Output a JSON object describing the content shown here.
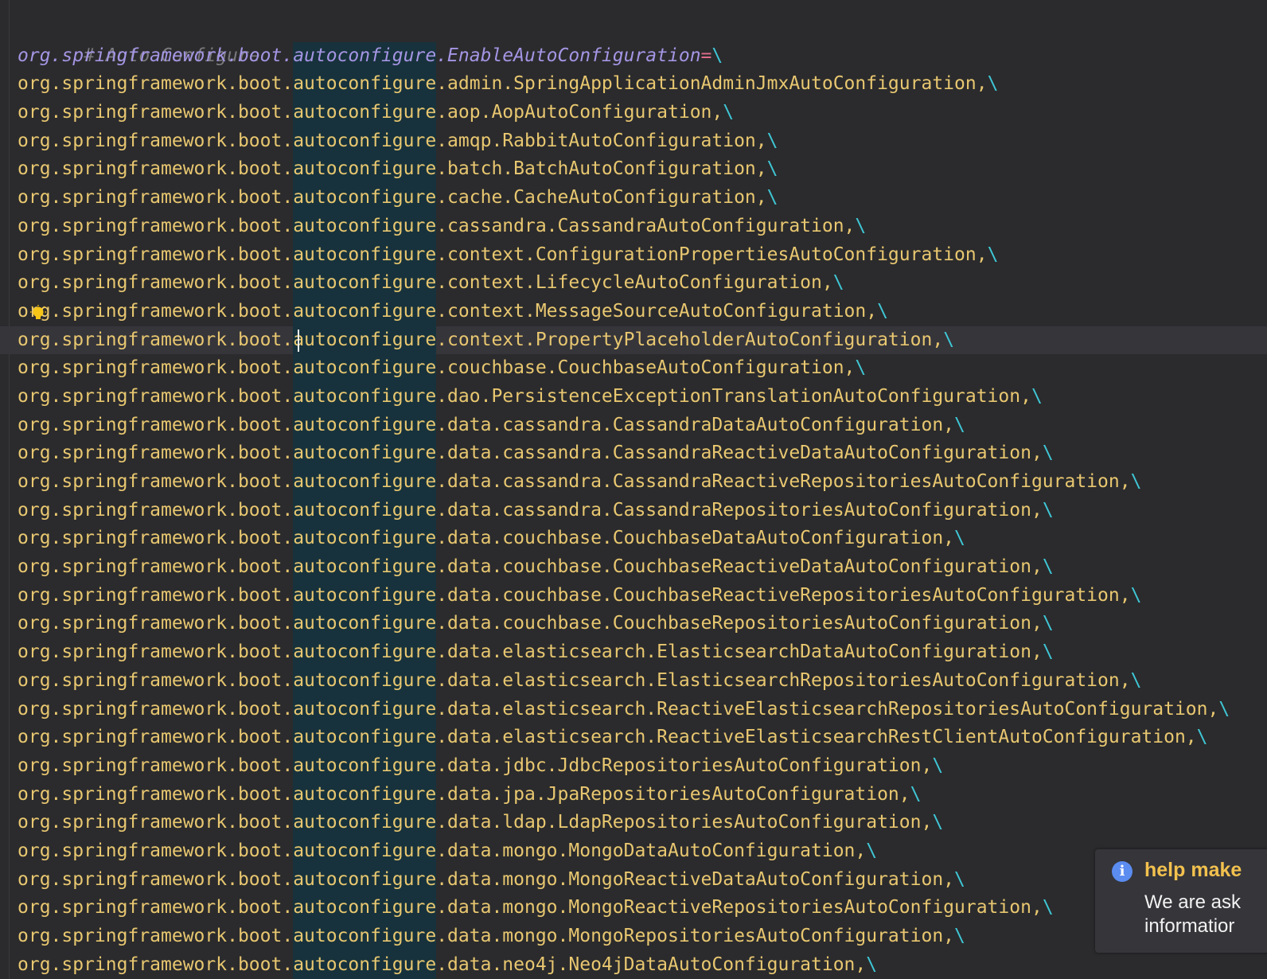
{
  "editor": {
    "comment": "# Auto Configure",
    "key": {
      "prefix": "org.springframework.boot.",
      "highlighted": "autoconfigure",
      "suffix": ".EnableAutoConfiguration",
      "equals": "=",
      "continuation": "\\"
    },
    "lines": [
      {
        "prefix": "org.springframework.boot.",
        "highlighted": "autoconfigure",
        "suffix": ".admin.SpringApplicationAdminJmxAutoConfiguration,",
        "continuation": "\\"
      },
      {
        "prefix": "org.springframework.boot.",
        "highlighted": "autoconfigure",
        "suffix": ".aop.AopAutoConfiguration,",
        "continuation": "\\"
      },
      {
        "prefix": "org.springframework.boot.",
        "highlighted": "autoconfigure",
        "suffix": ".amqp.RabbitAutoConfiguration,",
        "continuation": "\\"
      },
      {
        "prefix": "org.springframework.boot.",
        "highlighted": "autoconfigure",
        "suffix": ".batch.BatchAutoConfiguration,",
        "continuation": "\\"
      },
      {
        "prefix": "org.springframework.boot.",
        "highlighted": "autoconfigure",
        "suffix": ".cache.CacheAutoConfiguration,",
        "continuation": "\\"
      },
      {
        "prefix": "org.springframework.boot.",
        "highlighted": "autoconfigure",
        "suffix": ".cassandra.CassandraAutoConfiguration,",
        "continuation": "\\"
      },
      {
        "prefix": "org.springframework.boot.",
        "highlighted": "autoconfigure",
        "suffix": ".context.ConfigurationPropertiesAutoConfiguration,",
        "continuation": "\\"
      },
      {
        "prefix": "org.springframework.boot.",
        "highlighted": "autoconfigure",
        "suffix": ".context.LifecycleAutoConfiguration,",
        "continuation": "\\"
      },
      {
        "prefix": "org.springframework.boot.",
        "highlighted": "autoconfigure",
        "suffix": ".context.MessageSourceAutoConfiguration,",
        "continuation": "\\"
      },
      {
        "prefix": "org.springframework.boot.",
        "highlighted": "autoconfigure",
        "suffix": ".context.PropertyPlaceholderAutoConfiguration,",
        "continuation": "\\"
      },
      {
        "prefix": "org.springframework.boot.",
        "highlighted": "autoconfigure",
        "suffix": ".couchbase.CouchbaseAutoConfiguration,",
        "continuation": "\\"
      },
      {
        "prefix": "org.springframework.boot.",
        "highlighted": "autoconfigure",
        "suffix": ".dao.PersistenceExceptionTranslationAutoConfiguration,",
        "continuation": "\\"
      },
      {
        "prefix": "org.springframework.boot.",
        "highlighted": "autoconfigure",
        "suffix": ".data.cassandra.CassandraDataAutoConfiguration,",
        "continuation": "\\"
      },
      {
        "prefix": "org.springframework.boot.",
        "highlighted": "autoconfigure",
        "suffix": ".data.cassandra.CassandraReactiveDataAutoConfiguration,",
        "continuation": "\\"
      },
      {
        "prefix": "org.springframework.boot.",
        "highlighted": "autoconfigure",
        "suffix": ".data.cassandra.CassandraReactiveRepositoriesAutoConfiguration,",
        "continuation": "\\"
      },
      {
        "prefix": "org.springframework.boot.",
        "highlighted": "autoconfigure",
        "suffix": ".data.cassandra.CassandraRepositoriesAutoConfiguration,",
        "continuation": "\\"
      },
      {
        "prefix": "org.springframework.boot.",
        "highlighted": "autoconfigure",
        "suffix": ".data.couchbase.CouchbaseDataAutoConfiguration,",
        "continuation": "\\"
      },
      {
        "prefix": "org.springframework.boot.",
        "highlighted": "autoconfigure",
        "suffix": ".data.couchbase.CouchbaseReactiveDataAutoConfiguration,",
        "continuation": "\\"
      },
      {
        "prefix": "org.springframework.boot.",
        "highlighted": "autoconfigure",
        "suffix": ".data.couchbase.CouchbaseReactiveRepositoriesAutoConfiguration,",
        "continuation": "\\"
      },
      {
        "prefix": "org.springframework.boot.",
        "highlighted": "autoconfigure",
        "suffix": ".data.couchbase.CouchbaseRepositoriesAutoConfiguration,",
        "continuation": "\\"
      },
      {
        "prefix": "org.springframework.boot.",
        "highlighted": "autoconfigure",
        "suffix": ".data.elasticsearch.ElasticsearchDataAutoConfiguration,",
        "continuation": "\\"
      },
      {
        "prefix": "org.springframework.boot.",
        "highlighted": "autoconfigure",
        "suffix": ".data.elasticsearch.ElasticsearchRepositoriesAutoConfiguration,",
        "continuation": "\\"
      },
      {
        "prefix": "org.springframework.boot.",
        "highlighted": "autoconfigure",
        "suffix": ".data.elasticsearch.ReactiveElasticsearchRepositoriesAutoConfiguration,",
        "continuation": "\\"
      },
      {
        "prefix": "org.springframework.boot.",
        "highlighted": "autoconfigure",
        "suffix": ".data.elasticsearch.ReactiveElasticsearchRestClientAutoConfiguration,",
        "continuation": "\\"
      },
      {
        "prefix": "org.springframework.boot.",
        "highlighted": "autoconfigure",
        "suffix": ".data.jdbc.JdbcRepositoriesAutoConfiguration,",
        "continuation": "\\"
      },
      {
        "prefix": "org.springframework.boot.",
        "highlighted": "autoconfigure",
        "suffix": ".data.jpa.JpaRepositoriesAutoConfiguration,",
        "continuation": "\\"
      },
      {
        "prefix": "org.springframework.boot.",
        "highlighted": "autoconfigure",
        "suffix": ".data.ldap.LdapRepositoriesAutoConfiguration,",
        "continuation": "\\"
      },
      {
        "prefix": "org.springframework.boot.",
        "highlighted": "autoconfigure",
        "suffix": ".data.mongo.MongoDataAutoConfiguration,",
        "continuation": "\\"
      },
      {
        "prefix": "org.springframework.boot.",
        "highlighted": "autoconfigure",
        "suffix": ".data.mongo.MongoReactiveDataAutoConfiguration,",
        "continuation": "\\"
      },
      {
        "prefix": "org.springframework.boot.",
        "highlighted": "autoconfigure",
        "suffix": ".data.mongo.MongoReactiveRepositoriesAutoConfiguration,",
        "continuation": "\\"
      },
      {
        "prefix": "org.springframework.boot.",
        "highlighted": "autoconfigure",
        "suffix": ".data.mongo.MongoRepositoriesAutoConfiguration,",
        "continuation": "\\"
      },
      {
        "prefix": "org.springframework.boot.",
        "highlighted": "autoconfigure",
        "suffix": ".data.neo4j.Neo4jDataAutoConfiguration,",
        "continuation": "\\"
      }
    ],
    "current_line_index": 9
  },
  "notification": {
    "icon": "info-icon",
    "title": "help make",
    "body_line1": "We are ask",
    "body_line2": "informatior"
  },
  "colors": {
    "background": "#2b2b2d",
    "value_text": "#e8c770",
    "key_text": "#a595e4",
    "equals": "#e06c8a",
    "continuation": "#3fc7d6",
    "comment": "#7a7a7e",
    "selection_highlight": "#17323c",
    "notification_title": "#f2c14e",
    "info_icon": "#5b8cf0"
  }
}
